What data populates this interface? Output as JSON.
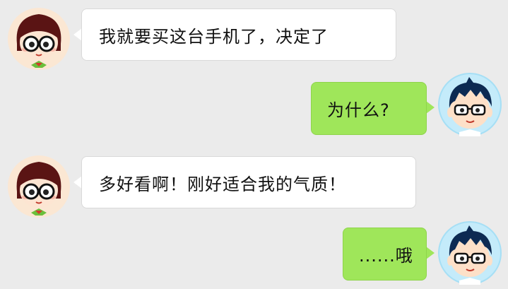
{
  "conversation": {
    "messages": [
      {
        "sender": "girl",
        "side": "left",
        "text": "我就要买这台手机了，决定了"
      },
      {
        "sender": "boy",
        "side": "right",
        "text": "为什么?"
      },
      {
        "sender": "girl",
        "side": "left",
        "text": "多好看啊！刚好适合我的气质！"
      },
      {
        "sender": "boy",
        "side": "right",
        "text": "......哦"
      }
    ]
  },
  "avatars": {
    "girl": {
      "icon": "girl-glasses-avatar-icon",
      "hair_color": "#5a1414",
      "skin_color": "#fde5d2"
    },
    "boy": {
      "icon": "boy-glasses-avatar-icon",
      "hair_color": "#0d2a52",
      "skin_color": "#fde0c8",
      "ring_color": "#a6dff5"
    }
  },
  "colors": {
    "background": "#ebebeb",
    "sent_bubble": "#9fe65a",
    "received_bubble": "#ffffff"
  }
}
